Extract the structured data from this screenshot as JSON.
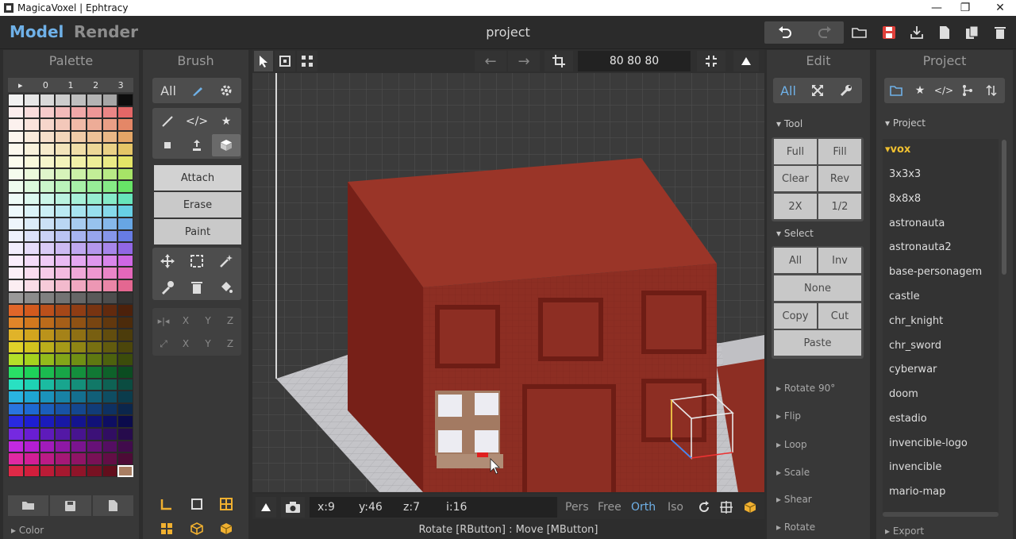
{
  "window": {
    "title": "MagicaVoxel | Ephtracy"
  },
  "header": {
    "mode_model": "Model",
    "mode_render": "Render",
    "project_title": "project"
  },
  "palette": {
    "title": "Palette",
    "tabs": [
      "▸",
      "0",
      "1",
      "2",
      "3"
    ],
    "section_color": "▸ Color",
    "selected_color": "#a87d62"
  },
  "brush": {
    "title": "Brush",
    "filter_all": "All",
    "modes": {
      "attach": "Attach",
      "erase": "Erase",
      "paint": "Paint"
    },
    "axis_row1": [
      "X",
      "Y",
      "Z"
    ],
    "axis_row2": [
      "X",
      "Y",
      "Z"
    ]
  },
  "viewport": {
    "dims": "80  80  80",
    "coords": {
      "x": "x:9",
      "y": "y:46",
      "z": "z:7",
      "i": "i:16"
    },
    "views": {
      "pers": "Pers",
      "free": "Free",
      "orth": "Orth",
      "iso": "Iso"
    },
    "status": "Rotate [RButton] : Move [MButton]"
  },
  "edit": {
    "title": "Edit",
    "filter_all": "All",
    "tool_section": "▾ Tool",
    "tool_buttons": [
      "Full",
      "Fill",
      "Clear",
      "Rev",
      "2X",
      "1/2"
    ],
    "select_section": "▾ Select",
    "select_buttons": {
      "all": "All",
      "inv": "Inv",
      "none": "None",
      "copy": "Copy",
      "cut": "Cut",
      "paste": "Paste"
    },
    "collapsed_sections": [
      "▸ Rotate 90°",
      "▸ Flip",
      "▸ Loop",
      "▸ Scale",
      "▸ Shear",
      "▸ Rotate"
    ]
  },
  "project": {
    "title": "Project",
    "section": "▾ Project",
    "folder": "▾vox",
    "items": [
      "3x3x3",
      "8x8x8",
      "astronauta",
      "astronauta2",
      "base-personagem",
      "castle",
      "chr_knight",
      "chr_sword",
      "cyberwar",
      "doom",
      "estadio",
      "invencible-logo",
      "invencible",
      "mario-map"
    ],
    "export_section": "▸ Export"
  },
  "colors": {
    "accent": "#6fb1e8",
    "brick": "#8e2e22",
    "save_red": "#e0403a",
    "folder_yellow": "#f0c030"
  }
}
